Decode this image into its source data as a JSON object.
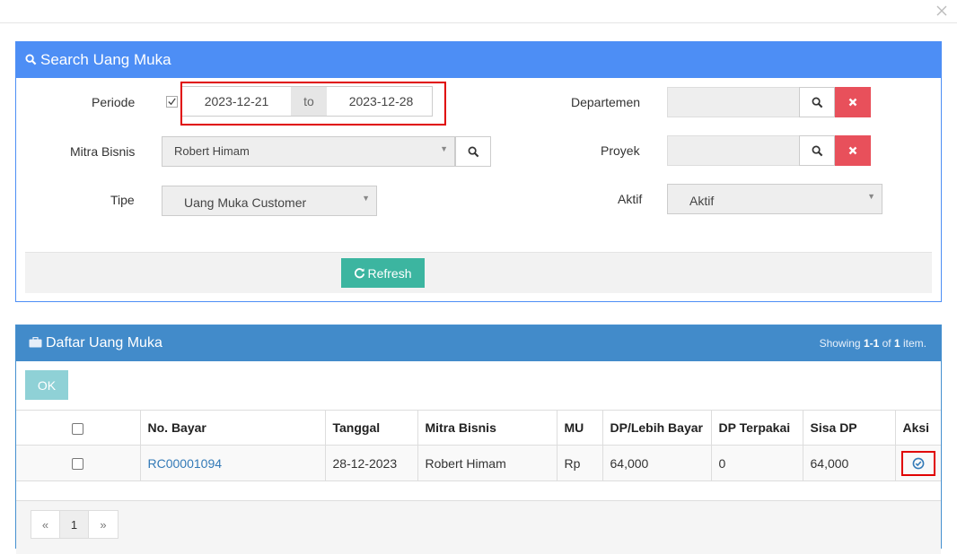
{
  "search": {
    "title": "Search Uang Muka",
    "periode_label": "Periode",
    "date_from": "2023-12-21",
    "date_to_sep": "to",
    "date_to": "2023-12-28",
    "mitra_label": "Mitra Bisnis",
    "mitra_value": "Robert Himam",
    "tipe_label": "Tipe",
    "tipe_value": "Uang Muka Customer",
    "departemen_label": "Departemen",
    "proyek_label": "Proyek",
    "aktif_label": "Aktif",
    "aktif_value": "Aktif",
    "refresh_label": "Refresh"
  },
  "list": {
    "title": "Daftar Uang Muka",
    "showing_prefix": "Showing ",
    "showing_range": "1-1",
    "showing_of": " of ",
    "showing_total": "1",
    "showing_suffix": " item.",
    "ok_label": "OK",
    "columns": [
      "No. Bayar",
      "Tanggal",
      "Mitra Bisnis",
      "MU",
      "DP/Lebih Bayar",
      "DP Terpakai",
      "Sisa DP",
      "Aksi"
    ],
    "rows": [
      {
        "no_bayar": "RC00001094",
        "tanggal": "28-12-2023",
        "mitra": "Robert Himam",
        "mu": "Rp",
        "dp": "64,000",
        "terpakai": "0",
        "sisa": "64,000"
      }
    ],
    "pager": {
      "prev": "«",
      "page": "1",
      "next": "»"
    }
  },
  "colors": {
    "search_header": "#4d8ef5",
    "list_header": "#428bca",
    "refresh": "#3cb5a0",
    "clear": "#e8505b",
    "highlight": "#e00000"
  }
}
